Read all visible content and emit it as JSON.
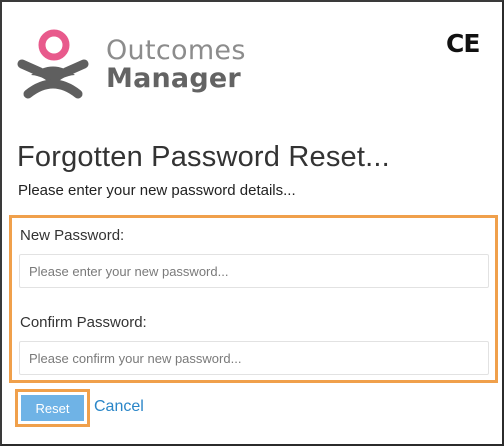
{
  "brand": {
    "line1": "Outcomes",
    "line2": "Manager",
    "ce_mark": "CE"
  },
  "page": {
    "title": "Forgotten Password Reset...",
    "subtitle": "Please enter your new password details..."
  },
  "form": {
    "new_password": {
      "label": "New Password:",
      "value": "",
      "placeholder": "Please enter your new password..."
    },
    "confirm_password": {
      "label": "Confirm Password:",
      "value": "",
      "placeholder": "Please confirm your new password..."
    }
  },
  "actions": {
    "reset_label": "Reset",
    "cancel_label": "Cancel"
  },
  "colors": {
    "logo_pink": "#e85a8c",
    "logo_gray": "#5f5f5f",
    "highlight_orange": "#f0a04b",
    "button_blue": "#6fb3e6",
    "link_blue": "#2a86c8"
  },
  "icons": {
    "logo": "outcomes-manager-logo-icon",
    "ce": "ce-mark-icon"
  }
}
